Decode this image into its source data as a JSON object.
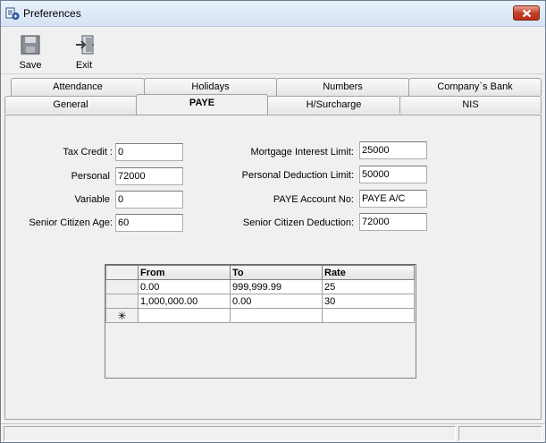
{
  "window": {
    "title": "Preferences"
  },
  "toolbar": {
    "save_label": "Save",
    "exit_label": "Exit"
  },
  "tabs": {
    "back": [
      "Attendance",
      "Holidays",
      "Numbers",
      "Company`s Bank"
    ],
    "front": [
      "General",
      "PAYE",
      "H/Surcharge",
      "NIS"
    ],
    "active": "PAYE"
  },
  "paye": {
    "left": [
      {
        "label": "Tax Credit :",
        "value": "0"
      },
      {
        "label": "Personal",
        "value": "72000"
      },
      {
        "label": "Variable",
        "value": "0"
      },
      {
        "label": "Senior Citizen Age:",
        "value": "60"
      }
    ],
    "right": [
      {
        "label": "Mortgage Interest Limit:",
        "value": "25000"
      },
      {
        "label": "Personal Deduction Limit:",
        "value": "50000"
      },
      {
        "label": "PAYE Account No:",
        "value": "PAYE A/C"
      },
      {
        "label": "Senior Citizen Deduction:",
        "value": "72000"
      }
    ]
  },
  "grid": {
    "columns": [
      "From",
      "To",
      "Rate"
    ],
    "rows": [
      [
        "0.00",
        "999,999.99",
        "25"
      ],
      [
        "1,000,000.00",
        "0.00",
        "30"
      ]
    ],
    "new_row_marker": "✳"
  },
  "colors": {
    "title_gradient_top": "#e9f1fb",
    "close_button": "#c5402a",
    "panel_bg": "#f0f0f0"
  }
}
